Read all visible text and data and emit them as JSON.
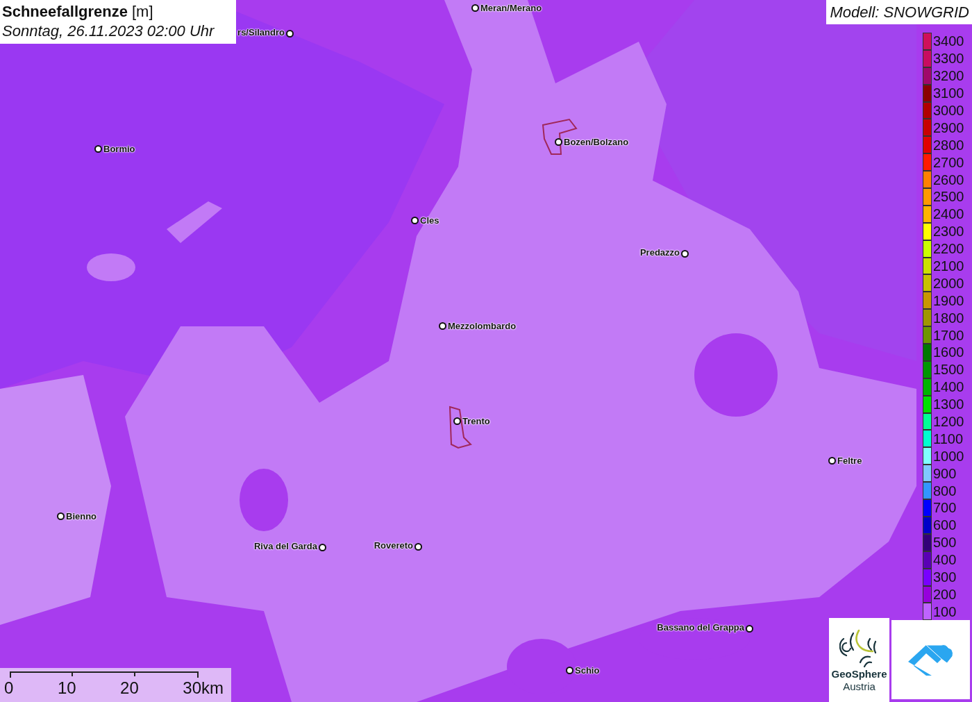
{
  "title": {
    "name": "Schneefallgrenze",
    "unit": "[m]",
    "time": "Sonntag, 26.11.2023 02:00 Uhr"
  },
  "model": "Modell: SNOWGRID",
  "places": [
    {
      "name": "Meran/Merano"
    },
    {
      "name": "rs/Silandro"
    },
    {
      "name": "Bormio"
    },
    {
      "name": "Bozen/Bolzano"
    },
    {
      "name": "Cles"
    },
    {
      "name": "Predazzo"
    },
    {
      "name": "Mezzolombardo"
    },
    {
      "name": "Trento"
    },
    {
      "name": "Feltre"
    },
    {
      "name": "Bienno"
    },
    {
      "name": "Riva del Garda"
    },
    {
      "name": "Rovereto"
    },
    {
      "name": "Bassano del Grappa"
    },
    {
      "name": "Schio"
    }
  ],
  "legend": [
    {
      "label": "3400",
      "color": "#d0105a"
    },
    {
      "label": "3300",
      "color": "#c80c60"
    },
    {
      "label": "3200",
      "color": "#a0086a"
    },
    {
      "label": "3100",
      "color": "#8b0000"
    },
    {
      "label": "3000",
      "color": "#b00000"
    },
    {
      "label": "2900",
      "color": "#c80000"
    },
    {
      "label": "2800",
      "color": "#e00000"
    },
    {
      "label": "2700",
      "color": "#ff1a00"
    },
    {
      "label": "2600",
      "color": "#ff8000"
    },
    {
      "label": "2500",
      "color": "#ff9900"
    },
    {
      "label": "2400",
      "color": "#ffb300"
    },
    {
      "label": "2300",
      "color": "#ffff00"
    },
    {
      "label": "2200",
      "color": "#ccff00"
    },
    {
      "label": "2100",
      "color": "#cce000"
    },
    {
      "label": "2000",
      "color": "#c8c000"
    },
    {
      "label": "1900",
      "color": "#c89600"
    },
    {
      "label": "1800",
      "color": "#a09600"
    },
    {
      "label": "1700",
      "color": "#6e9600"
    },
    {
      "label": "1600",
      "color": "#007800"
    },
    {
      "label": "1500",
      "color": "#009600"
    },
    {
      "label": "1400",
      "color": "#00b400"
    },
    {
      "label": "1300",
      "color": "#00e000"
    },
    {
      "label": "1200",
      "color": "#00ff96"
    },
    {
      "label": "1100",
      "color": "#00ffd0"
    },
    {
      "label": "1000",
      "color": "#80ffff"
    },
    {
      "label": "900",
      "color": "#80c8ff"
    },
    {
      "label": "800",
      "color": "#3296ff"
    },
    {
      "label": "700",
      "color": "#0000ff"
    },
    {
      "label": "600",
      "color": "#0000c8"
    },
    {
      "label": "500",
      "color": "#320078"
    },
    {
      "label": "400",
      "color": "#5a00b4"
    },
    {
      "label": "300",
      "color": "#7800ff"
    },
    {
      "label": "200",
      "color": "#9600dc"
    },
    {
      "label": "100",
      "color": "#be64ff"
    }
  ],
  "scale": [
    "0",
    "10",
    "20",
    "30km"
  ],
  "logo": {
    "line1": "GeoSphere",
    "line2": "Austria"
  }
}
